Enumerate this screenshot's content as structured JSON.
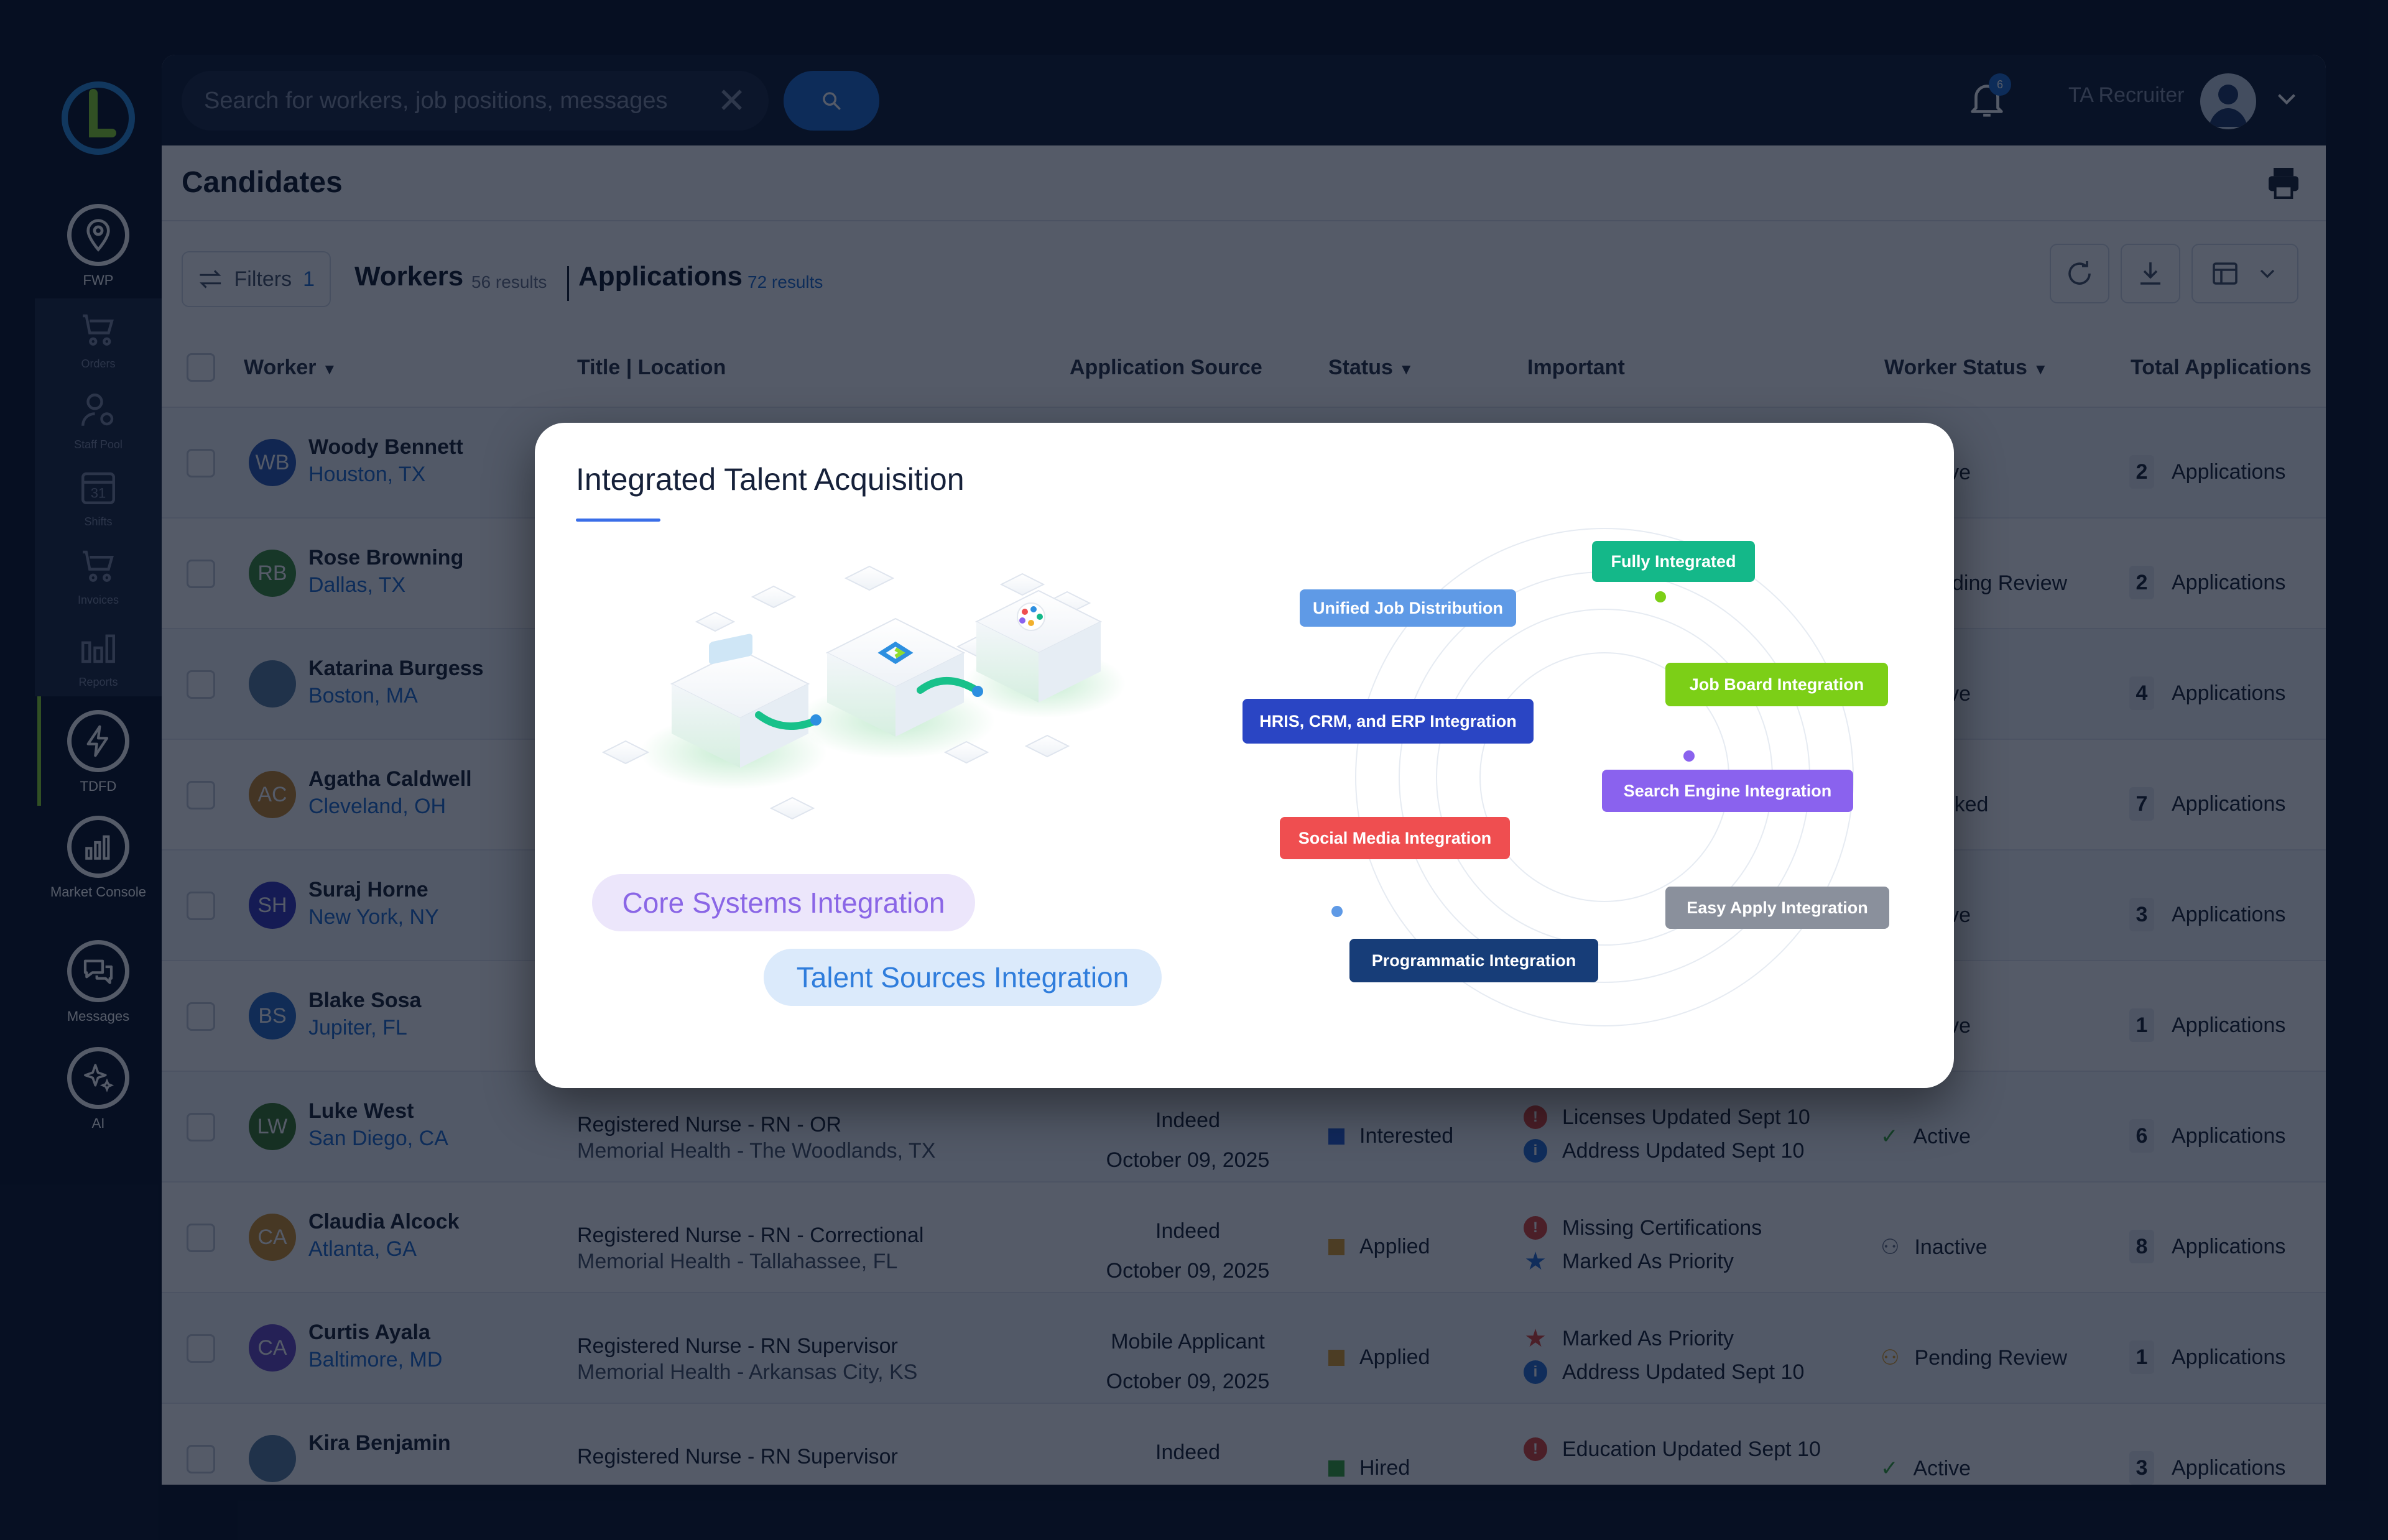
{
  "sidebar": {
    "items": [
      {
        "label": "FWP",
        "icon": "location-pin-icon"
      },
      {
        "label": "Orders",
        "icon": "cart-icon"
      },
      {
        "label": "Staff Pool",
        "icon": "person-gear-icon"
      },
      {
        "label": "Shifts",
        "icon": "calendar-icon",
        "icon_text": "31"
      },
      {
        "label": "Invoices",
        "icon": "cart-dollar-icon"
      },
      {
        "label": "Reports",
        "icon": "bar-chart-icon"
      },
      {
        "label": "TDFD",
        "icon": "lightning-icon"
      },
      {
        "label": "Market Console",
        "icon": "analytics-icon"
      },
      {
        "label": "Messages",
        "icon": "chat-bubbles-icon"
      },
      {
        "label": "AI",
        "icon": "sparkles-icon"
      }
    ],
    "active_accent": "#8fdc2c"
  },
  "header": {
    "search_placeholder": "Search for workers, job positions, messages",
    "clear_symbol": "✕",
    "notifications_count": "6",
    "user_role": "TA Recruiter"
  },
  "page": {
    "title": "Candidates",
    "filters_label": "Filters",
    "filters_count": "1",
    "tabs": [
      {
        "label": "Workers",
        "count": "56 results"
      },
      {
        "label": "Applications",
        "count": "72 results"
      }
    ]
  },
  "table": {
    "columns": [
      "Worker",
      "Title |  Location",
      "Application Source",
      "Status",
      "Important",
      "Worker Status",
      "Total Applications"
    ],
    "rows": [
      {
        "initials": "WB",
        "name": "Woody Bennett",
        "location": "Houston, TX",
        "avatar_color": "#2d5bb8",
        "worker_status": "Active",
        "total": "2",
        "total_label": "Applications"
      },
      {
        "initials": "RB",
        "name": "Rose Browning",
        "location": "Dallas, TX",
        "avatar_color": "#3f8f3a",
        "worker_status": "Pending Review",
        "total": "2",
        "total_label": "Applications"
      },
      {
        "initials": "",
        "name": "Katarina Burgess",
        "location": "Boston, MA",
        "avatar_color": "#5b7fa3",
        "worker_status": "Active",
        "total": "4",
        "total_label": "Applications"
      },
      {
        "initials": "AC",
        "name": "Agatha Caldwell",
        "location": "Cleveland, OH",
        "avatar_color": "#c9892c",
        "worker_status": "Blocked",
        "total": "7",
        "total_label": "Applications"
      },
      {
        "initials": "SH",
        "name": "Suraj Horne",
        "location": "New York, NY",
        "avatar_color": "#3a3ac2",
        "worker_status": "Active",
        "total": "3",
        "total_label": "Applications"
      },
      {
        "initials": "BS",
        "name": "Blake Sosa",
        "location": "Jupiter, FL",
        "avatar_color": "#2d6fc8",
        "worker_status": "Active",
        "total": "1",
        "total_label": "Applications"
      },
      {
        "initials": "LW",
        "name": "Luke West",
        "location": "San Diego, CA",
        "avatar_color": "#3d7a2a",
        "title": "Registered Nurse - RN - OR",
        "facility": "Memorial Health - The Woodlands, TX",
        "source": "Indeed",
        "date": "October 09, 2025",
        "status": "Interested",
        "status_color": "#2a62d6",
        "important": [
          {
            "text": "Licenses Updated Sept 10",
            "icon": "alert-icon",
            "color": "#e0453a"
          },
          {
            "text": "Address Updated Sept 10",
            "icon": "info-icon",
            "color": "#2a72d6"
          }
        ],
        "worker_status": "Active",
        "total": "6",
        "total_label": "Applications"
      },
      {
        "initials": "CA",
        "name": "Claudia Alcock",
        "location": "Atlanta, GA",
        "avatar_color": "#d4922c",
        "title": "Registered Nurse - RN - Correctional",
        "facility": "Memorial Health - Tallahassee, FL",
        "source": "Indeed",
        "date": "October 09, 2025",
        "status": "Applied",
        "status_color": "#e2a22c",
        "important": [
          {
            "text": "Missing Certifications",
            "icon": "document-alert-icon",
            "color": "#e0453a"
          },
          {
            "text": "Marked As Priority",
            "icon": "star-icon",
            "color": "#2a72d6"
          }
        ],
        "worker_status": "Inactive",
        "total": "8",
        "total_label": "Applications"
      },
      {
        "initials": "CA",
        "name": "Curtis Ayala",
        "location": "Baltimore, MD",
        "avatar_color": "#6a4cc8",
        "title": "Registered Nurse - RN Supervisor",
        "facility": "Memorial Health - Arkansas City, KS",
        "source": "Mobile Applicant",
        "date": "October 09, 2025",
        "status": "Applied",
        "status_color": "#e2a22c",
        "important": [
          {
            "text": "Marked As Priority",
            "icon": "star-icon",
            "color": "#e0453a"
          },
          {
            "text": "Address Updated Sept 10",
            "icon": "info-icon",
            "color": "#2a72d6"
          }
        ],
        "worker_status": "Pending Review",
        "total": "1",
        "total_label": "Applications"
      },
      {
        "initials": "",
        "name": "Kira Benjamin",
        "location": "",
        "avatar_color": "#5b7fa3",
        "title": "Registered Nurse - RN Supervisor",
        "facility": "",
        "source": "Indeed",
        "date": "",
        "status": "Hired",
        "status_color": "#3aa93a",
        "important": [
          {
            "text": "Education Updated Sept 10",
            "icon": "alert-icon",
            "color": "#e0453a"
          }
        ],
        "worker_status": "Active",
        "total": "3",
        "total_label": "Applications"
      }
    ]
  },
  "modal": {
    "title": "Integrated Talent Acquisition",
    "accent": "#3a6ee8",
    "pills": [
      "Core Systems Integration",
      "Talent Sources Integration"
    ],
    "tags": [
      {
        "label": "Fully Integrated",
        "color": "#14b889"
      },
      {
        "label": "Unified Job Distribution",
        "color": "#5f9ae6"
      },
      {
        "label": "Job Board Integration",
        "color": "#7ccf17"
      },
      {
        "label": "HRIS, CRM, and ERP Integration",
        "color": "#2a45c4"
      },
      {
        "label": "Search Engine Integration",
        "color": "#8a62ee"
      },
      {
        "label": "Social Media Integration",
        "color": "#ef4e50"
      },
      {
        "label": "Easy Apply Integration",
        "color": "#8a909c"
      },
      {
        "label": "Programmatic Integration",
        "color": "#173d78"
      }
    ]
  }
}
